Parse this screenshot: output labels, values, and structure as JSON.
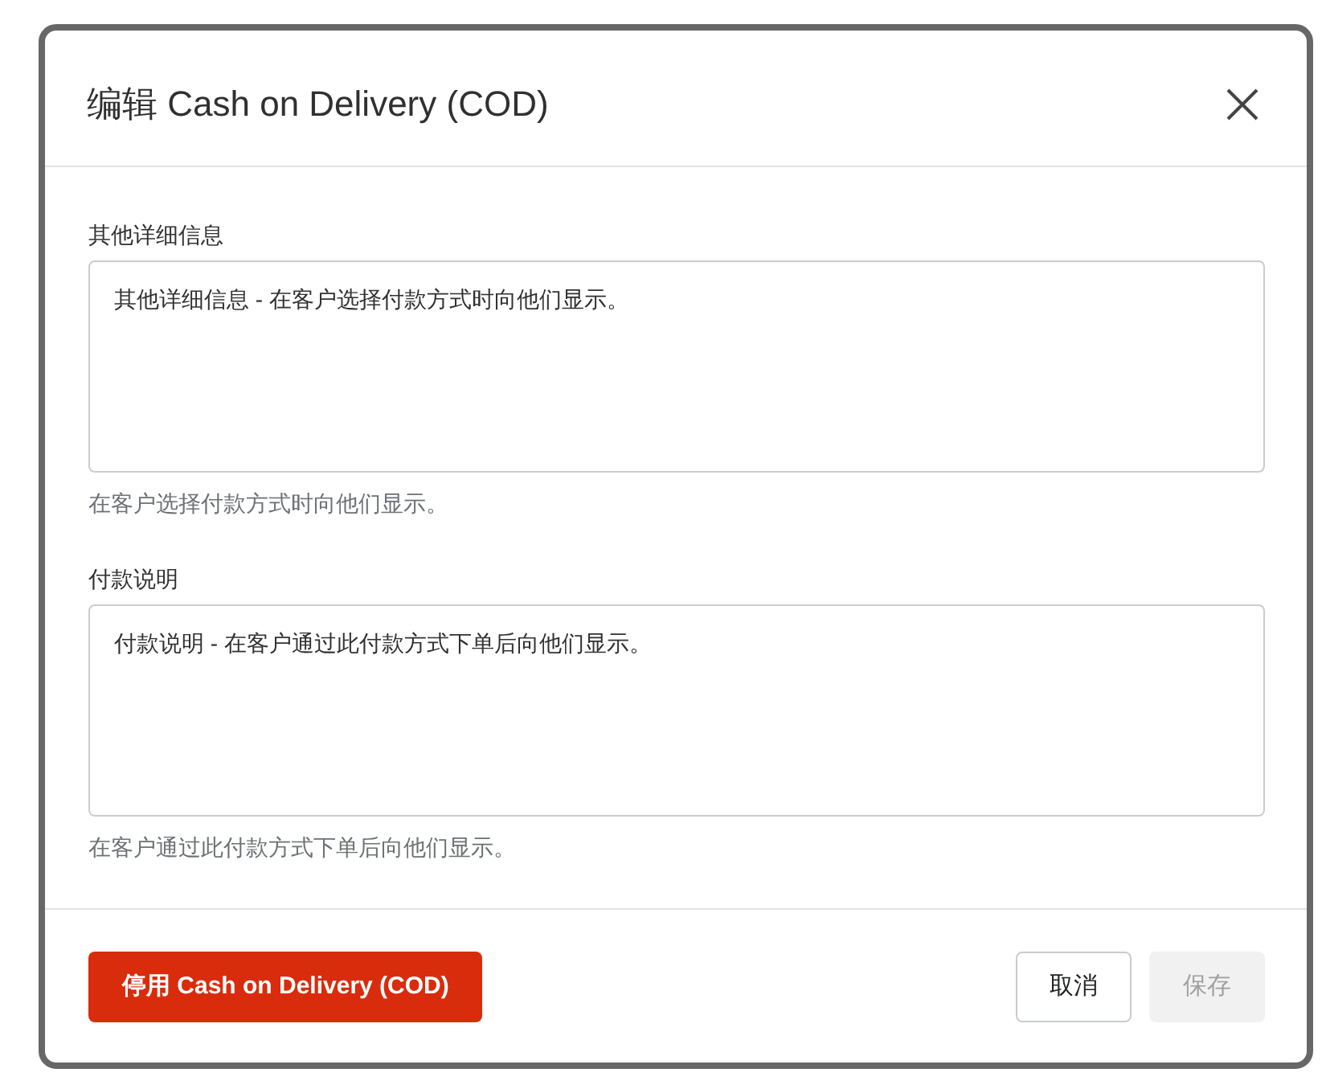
{
  "dialog": {
    "title": "编辑 Cash on Delivery (COD)"
  },
  "fields": [
    {
      "label": "其他详细信息",
      "value": "其他详细信息 - 在客户选择付款方式时向他们显示。",
      "help_text": "在客户选择付款方式时向他们显示。"
    },
    {
      "label": "付款说明",
      "value": "付款说明 - 在客户通过此付款方式下单后向他们显示。",
      "help_text": "在客户通过此付款方式下单后向他们显示。"
    }
  ],
  "footer": {
    "destructive_button": {
      "label": "停用 Cash on Delivery (COD)"
    },
    "buttons": [
      {
        "label": "取消",
        "disabled": false
      },
      {
        "label": "保存",
        "disabled": true
      }
    ]
  }
}
